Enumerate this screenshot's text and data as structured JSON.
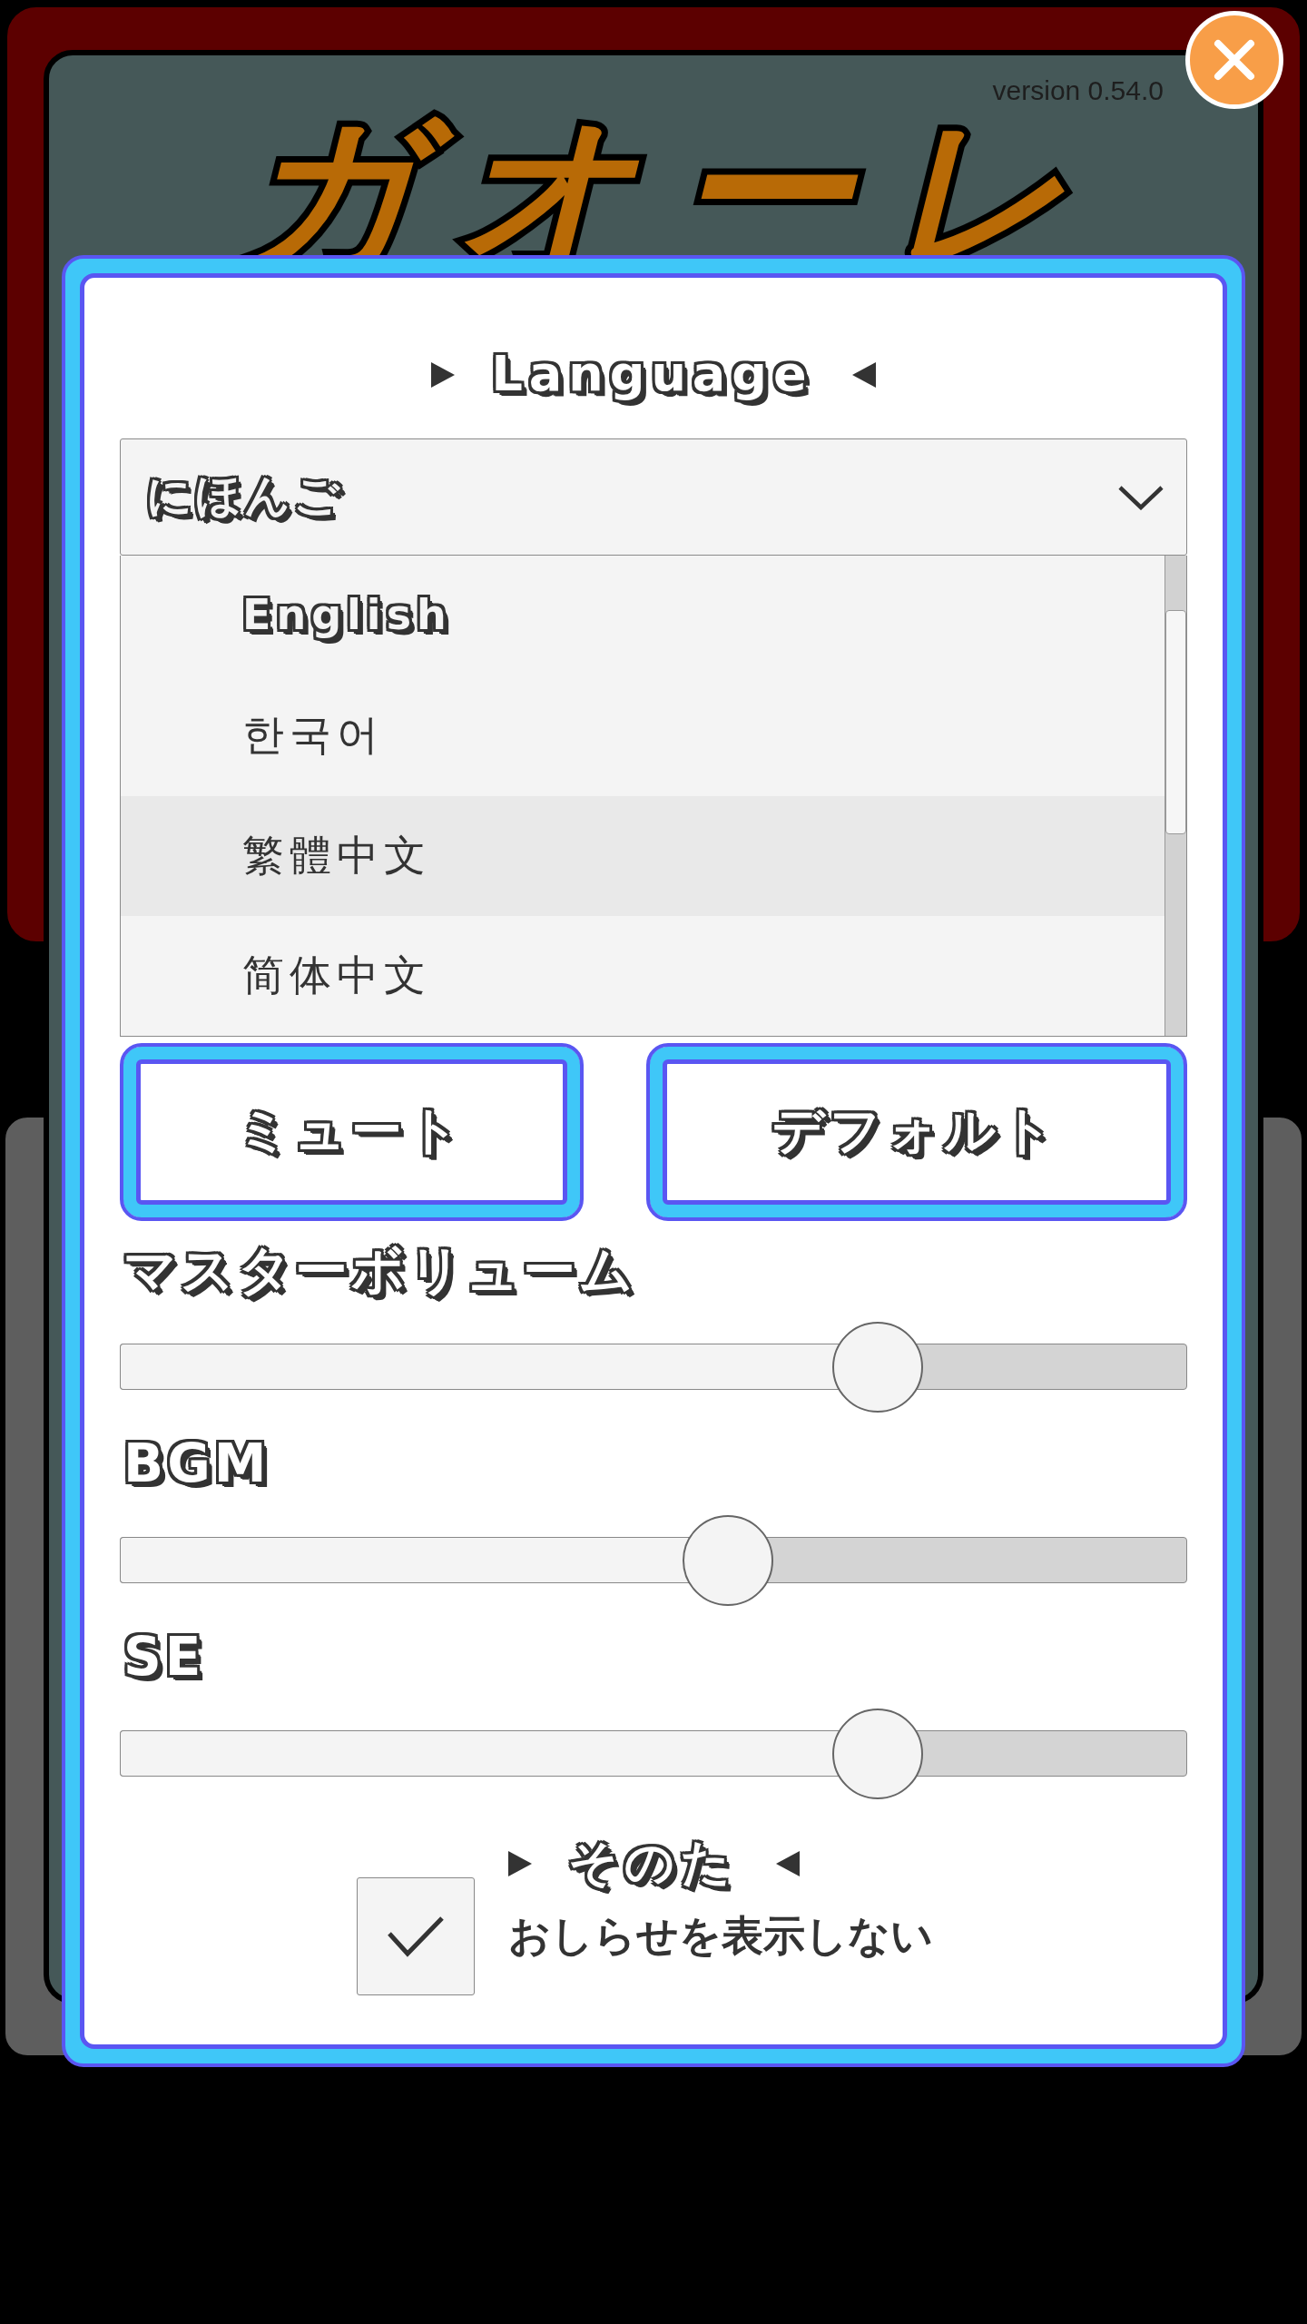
{
  "background": {
    "version": "version 0.54.0",
    "logo": "ガオーレ"
  },
  "dialog": {
    "language": {
      "heading": "Language",
      "value": "にほんご",
      "expanded": true,
      "options": [
        {
          "label": "English",
          "kind": "latin",
          "selected": false
        },
        {
          "label": "한국어",
          "kind": "plain",
          "selected": false
        },
        {
          "label": "繁體中文",
          "kind": "plain",
          "selected": true
        },
        {
          "label": "简体中文",
          "kind": "plain",
          "selected": false
        }
      ]
    },
    "buttons": [
      "ミュート",
      "デフォルト"
    ],
    "sliders": [
      {
        "label": "マスターボリューム",
        "level": 0.71
      },
      {
        "label": "BGM",
        "level": 0.57
      },
      {
        "label": "SE",
        "level": 0.71
      }
    ],
    "other": {
      "heading": "そのた",
      "checkbox": {
        "label": "おしらせを表示しない",
        "checked": true
      }
    }
  }
}
